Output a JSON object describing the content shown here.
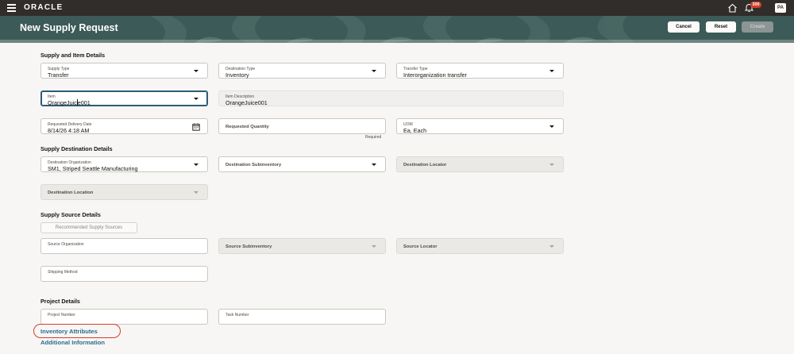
{
  "topbar": {
    "logo": "ORACLE",
    "notification_count": "300",
    "user_initials": "PA",
    "icons": [
      "hamburger-menu-icon",
      "home-icon",
      "bell-icon"
    ]
  },
  "header": {
    "title": "New Supply Request",
    "buttons": {
      "cancel": "Cancel",
      "reset": "Reset",
      "create": "Create"
    }
  },
  "sections": {
    "supply_item": "Supply and Item Details",
    "supply_destination": "Supply Destination Details",
    "supply_source": "Supply Source Details",
    "project": "Project Details"
  },
  "fields": {
    "supply_type": {
      "label": "Supply Type",
      "value": "Transfer"
    },
    "destination_type": {
      "label": "Destination Type",
      "value": "Inventory"
    },
    "transfer_type": {
      "label": "Transfer Type",
      "value": "Interorganization transfer"
    },
    "item": {
      "label": "Item",
      "value_before_cursor": "OrangeJuic",
      "value_after_cursor": "e001"
    },
    "item_description": {
      "label": "Item Description",
      "value": "OrangeJuice001"
    },
    "requested_delivery_date": {
      "label": "Requested Delivery Date",
      "value": "8/14/26 4:18 AM"
    },
    "requested_quantity": {
      "placeholder": "Requested Quantity",
      "required_note": "Required"
    },
    "uom": {
      "label": "UOM",
      "value": "Ea,  Each"
    },
    "destination_organization": {
      "label": "Destination Organization",
      "value": "SM1,  Striped Seattle Manufacturing"
    },
    "destination_subinventory": {
      "placeholder": "Destination Subinventory"
    },
    "destination_locator": {
      "placeholder": "Destination Locator"
    },
    "destination_location": {
      "placeholder": "Destination Location"
    },
    "source_organization": {
      "label": "Source Organization"
    },
    "source_subinventory": {
      "placeholder": "Source Subinventory"
    },
    "source_locator": {
      "placeholder": "Source Locator"
    },
    "shipping_method": {
      "label": "Shipping Method"
    },
    "project_number": {
      "label": "Project Number"
    },
    "task_number": {
      "label": "Task Number"
    }
  },
  "recommended_sources_button": "Recommended Supply Sources",
  "links": {
    "inventory_attributes": "Inventory Attributes",
    "additional_information": "Additional Information"
  },
  "colors": {
    "topbar": "#312d2a",
    "banner": "#3c5a57",
    "link": "#2a6c8e",
    "badge": "#d63b25",
    "annotation": "#d3402b"
  }
}
